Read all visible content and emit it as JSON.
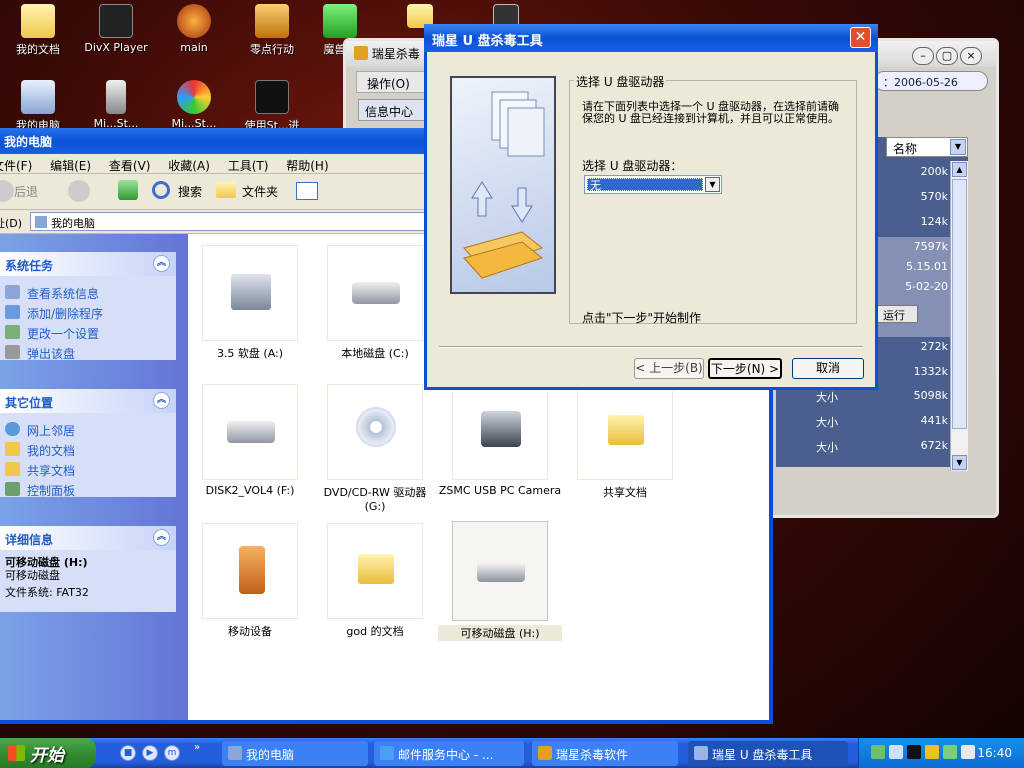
{
  "desktop": {
    "icons": [
      {
        "label": "我的文档"
      },
      {
        "label": "DivX Player"
      },
      {
        "label": "main"
      },
      {
        "label": "零点行动"
      },
      {
        "label": "魔兽简"
      },
      {
        "label": ""
      },
      {
        "label": ""
      },
      {
        "label": "我的电脑"
      },
      {
        "label": "Mi...St..."
      },
      {
        "label": "Mi...St..."
      },
      {
        "label": "使用St...进"
      }
    ]
  },
  "rx_window": {
    "title": "瑞星杀毒",
    "menu_label": "操作(O)",
    "info_tab": "信息中心",
    "date": "：2006-05-26",
    "column_header": "名称",
    "run_button": "运行",
    "rows": [
      {
        "c1": "",
        "c2": "200k"
      },
      {
        "c1": "",
        "c2": "570k"
      },
      {
        "c1": "",
        "c2": "124k"
      },
      {
        "c1": "",
        "c2": "7597k"
      },
      {
        "c1": "",
        "c2": "5.15.01"
      },
      {
        "c1": "",
        "c2": "5-02-20"
      },
      {
        "c1": "",
        "c2": ""
      },
      {
        "c1": "",
        "c2": "272k"
      },
      {
        "c1": "",
        "c2": "1332k"
      },
      {
        "c1": "大小",
        "c2": "5098k"
      },
      {
        "c1": "大小",
        "c2": "441k"
      },
      {
        "c1": "大小",
        "c2": "672k"
      }
    ]
  },
  "explorer": {
    "title": "我的电脑",
    "menu": [
      "文件(F)",
      "编辑(E)",
      "查看(V)",
      "收藏(A)",
      "工具(T)",
      "帮助(H)"
    ],
    "toolbar": {
      "back": "后退",
      "search": "搜索",
      "folders": "文件夹"
    },
    "address_label": "址(D)",
    "address_value": "我的电脑",
    "panels": {
      "system": {
        "title": "系统任务",
        "items": [
          "查看系统信息",
          "添加/删除程序",
          "更改一个设置",
          "弹出该盘"
        ]
      },
      "other": {
        "title": "其它位置",
        "items": [
          "网上邻居",
          "我的文档",
          "共享文档",
          "控制面板"
        ]
      },
      "details": {
        "title": "详细信息",
        "name": "可移动磁盘 (H:)",
        "type": "可移动磁盘",
        "fs": "文件系统: FAT32"
      }
    },
    "tiles": [
      {
        "label": "3.5 软盘 (A:)"
      },
      {
        "label": "本地磁盘 (C:)"
      },
      {
        "label": "DISK2_VOL4 (F:)"
      },
      {
        "label": "DVD/CD-RW 驱动器 (G:)"
      },
      {
        "label": "ZSMC USB PC Camera"
      },
      {
        "label": "共享文档"
      },
      {
        "label": "移动设备"
      },
      {
        "label": "god 的文档"
      },
      {
        "label": "可移动磁盘 (H:)"
      }
    ]
  },
  "dialog": {
    "title": "瑞星 U 盘杀毒工具",
    "close": "✕",
    "group_label": "选择 U 盘驱动器",
    "instruction": "请在下面列表中选择一个 U 盘驱动器，在选择前请确保您的 U 盘已经连接到计算机，并且可以正常使用。",
    "select_label": "选择 U 盘驱动器：",
    "select_value": "无",
    "hint": "点击\"下一步\"开始制作",
    "buttons": {
      "prev": "< 上一步(B)",
      "next": "下一步(N) >",
      "cancel": "取消"
    }
  },
  "taskbar": {
    "start": "开始",
    "tasks": [
      {
        "label": "我的电脑"
      },
      {
        "label": "邮件服务中心 - ..."
      },
      {
        "label": "瑞星杀毒软件"
      },
      {
        "label": "瑞星 U 盘杀毒工具"
      }
    ],
    "clock": "16:40"
  }
}
